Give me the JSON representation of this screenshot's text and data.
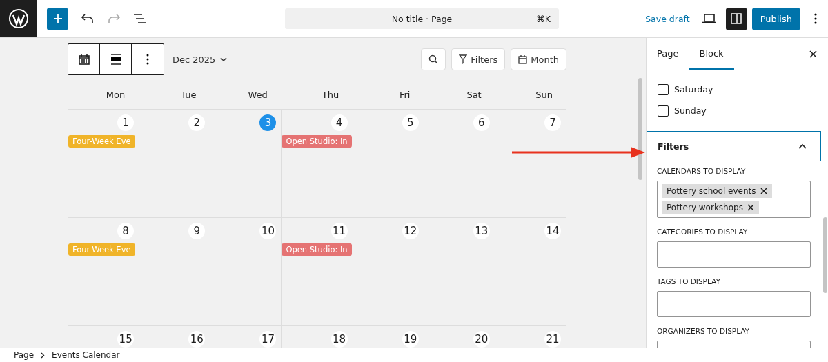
{
  "topbar": {
    "title": "No title · Page",
    "shortcut": "⌘K",
    "save": "Save draft",
    "publish": "Publish",
    "sidebar_toggle_on": true
  },
  "calendar": {
    "month": "Dec 2025",
    "filters": "Filters",
    "view": "Month",
    "weekdays": [
      "Mon",
      "Tue",
      "Wed",
      "Thu",
      "Fri",
      "Sat",
      "Sun"
    ],
    "weeks": [
      [
        {
          "day": "1",
          "today": false,
          "events": [
            {
              "title": "Four-Week Eve",
              "color": "#f0b429"
            }
          ]
        },
        {
          "day": "2",
          "today": false
        },
        {
          "day": "3",
          "today": true
        },
        {
          "day": "4",
          "today": false,
          "events": [
            {
              "title": "Open Studio: In",
              "color": "#e57373"
            }
          ]
        },
        {
          "day": "5",
          "today": false
        },
        {
          "day": "6",
          "today": false
        },
        {
          "day": "7",
          "today": false
        }
      ],
      [
        {
          "day": "8",
          "today": false,
          "events": [
            {
              "title": "Four-Week Eve",
              "color": "#f0b429"
            }
          ]
        },
        {
          "day": "9",
          "today": false
        },
        {
          "day": "10",
          "today": false
        },
        {
          "day": "11",
          "today": false,
          "events": [
            {
              "title": "Open Studio: In",
              "color": "#e57373"
            }
          ]
        },
        {
          "day": "12",
          "today": false
        },
        {
          "day": "13",
          "today": false
        },
        {
          "day": "14",
          "today": false
        }
      ],
      [
        {
          "day": "15",
          "today": false
        },
        {
          "day": "16",
          "today": false
        },
        {
          "day": "17",
          "today": false
        },
        {
          "day": "18",
          "today": false
        },
        {
          "day": "19",
          "today": false
        },
        {
          "day": "20",
          "today": false
        },
        {
          "day": "21",
          "today": false
        }
      ]
    ]
  },
  "sidebar": {
    "tabs": [
      {
        "label": "Page",
        "selected": false
      },
      {
        "label": "Block",
        "selected": true
      }
    ],
    "checkboxes": [
      {
        "label": "Saturday",
        "checked": false
      },
      {
        "label": "Sunday",
        "checked": false
      }
    ],
    "panel": {
      "title": "Filters",
      "expanded": true,
      "fields": [
        {
          "label": "CALENDARS TO DISPLAY",
          "tokens": [
            "Pottery school events",
            "Pottery workshops"
          ]
        },
        {
          "label": "CATEGORIES TO DISPLAY"
        },
        {
          "label": "TAGS TO DISPLAY"
        },
        {
          "label": "ORGANIZERS TO DISPLAY"
        }
      ]
    }
  },
  "breadcrumb": [
    "Page",
    "Events Calendar"
  ]
}
